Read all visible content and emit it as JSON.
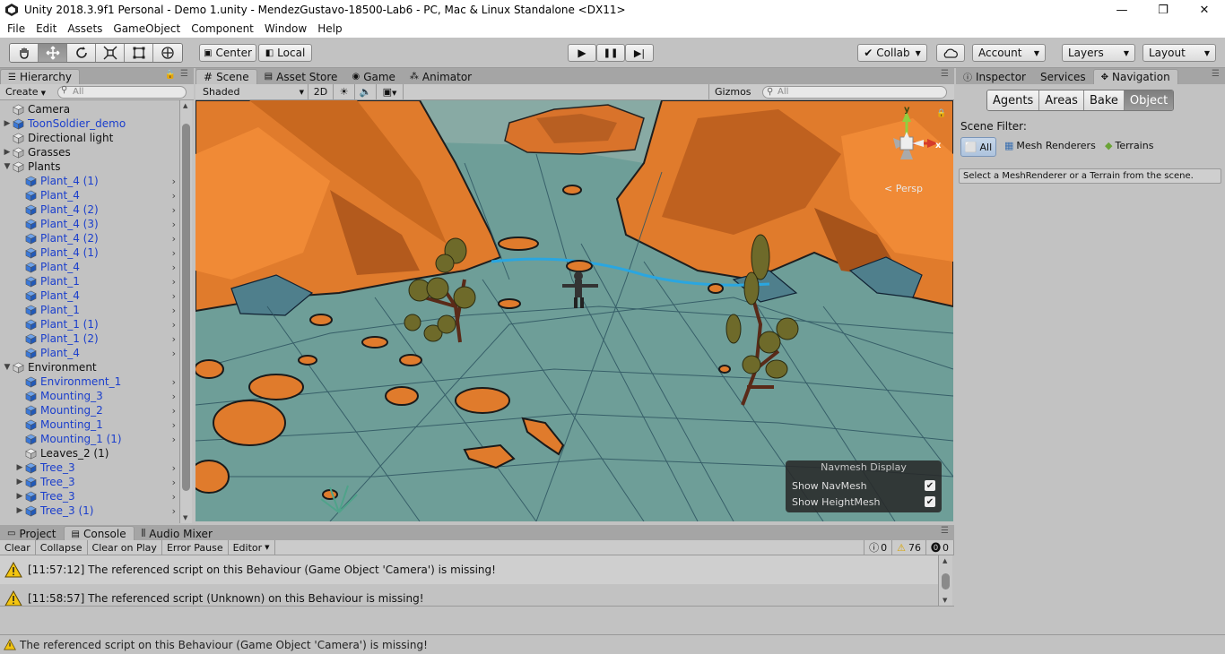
{
  "window": {
    "title": "Unity 2018.3.9f1 Personal - Demo 1.unity - MendezGustavo-18500-Lab6 - PC, Mac & Linux Standalone <DX11>",
    "controls": [
      "—",
      "❐",
      "✕"
    ]
  },
  "menu": [
    "File",
    "Edit",
    "Assets",
    "GameObject",
    "Component",
    "Window",
    "Help"
  ],
  "toolbar": {
    "tools": [
      "hand-tool-icon",
      "move-tool-icon",
      "rotate-tool-icon",
      "scale-tool-icon",
      "rect-tool-icon",
      "transform-tool-icon"
    ],
    "pivot_mode": "Center",
    "pivot_rotation": "Local",
    "play": "▶",
    "pause": "❚❚",
    "step": "▶|",
    "collab": "Collab",
    "account": "Account",
    "layers": "Layers",
    "layout": "Layout"
  },
  "hierarchy": {
    "tab": "Hierarchy",
    "create": "Create",
    "search_placeholder": "All",
    "items": [
      {
        "label": "Camera",
        "indent": 0,
        "arrow": "",
        "prefab": false,
        "chevron": false
      },
      {
        "label": "ToonSoldier_demo",
        "indent": 0,
        "arrow": "▶",
        "prefab": true,
        "chevron": false
      },
      {
        "label": "Directional light",
        "indent": 0,
        "arrow": "",
        "prefab": false,
        "chevron": false
      },
      {
        "label": "Grasses",
        "indent": 0,
        "arrow": "▶",
        "prefab": false,
        "chevron": false
      },
      {
        "label": "Plants",
        "indent": 0,
        "arrow": "▼",
        "prefab": false,
        "chevron": false
      },
      {
        "label": "Plant_4 (1)",
        "indent": 1,
        "arrow": "",
        "prefab": true,
        "chevron": true
      },
      {
        "label": "Plant_4",
        "indent": 1,
        "arrow": "",
        "prefab": true,
        "chevron": true
      },
      {
        "label": "Plant_4 (2)",
        "indent": 1,
        "arrow": "",
        "prefab": true,
        "chevron": true
      },
      {
        "label": "Plant_4 (3)",
        "indent": 1,
        "arrow": "",
        "prefab": true,
        "chevron": true
      },
      {
        "label": "Plant_4 (2)",
        "indent": 1,
        "arrow": "",
        "prefab": true,
        "chevron": true
      },
      {
        "label": "Plant_4 (1)",
        "indent": 1,
        "arrow": "",
        "prefab": true,
        "chevron": true
      },
      {
        "label": "Plant_4",
        "indent": 1,
        "arrow": "",
        "prefab": true,
        "chevron": true
      },
      {
        "label": "Plant_1",
        "indent": 1,
        "arrow": "",
        "prefab": true,
        "chevron": true
      },
      {
        "label": "Plant_4",
        "indent": 1,
        "arrow": "",
        "prefab": true,
        "chevron": true
      },
      {
        "label": "Plant_1",
        "indent": 1,
        "arrow": "",
        "prefab": true,
        "chevron": true
      },
      {
        "label": "Plant_1 (1)",
        "indent": 1,
        "arrow": "",
        "prefab": true,
        "chevron": true
      },
      {
        "label": "Plant_1 (2)",
        "indent": 1,
        "arrow": "",
        "prefab": true,
        "chevron": true
      },
      {
        "label": "Plant_4",
        "indent": 1,
        "arrow": "",
        "prefab": true,
        "chevron": true
      },
      {
        "label": "Environment",
        "indent": 0,
        "arrow": "▼",
        "prefab": false,
        "chevron": false
      },
      {
        "label": "Environment_1",
        "indent": 1,
        "arrow": "",
        "prefab": true,
        "chevron": true
      },
      {
        "label": "Mounting_3",
        "indent": 1,
        "arrow": "",
        "prefab": true,
        "chevron": true
      },
      {
        "label": "Mounting_2",
        "indent": 1,
        "arrow": "",
        "prefab": true,
        "chevron": true
      },
      {
        "label": "Mounting_1",
        "indent": 1,
        "arrow": "",
        "prefab": true,
        "chevron": true
      },
      {
        "label": "Mounting_1 (1)",
        "indent": 1,
        "arrow": "",
        "prefab": true,
        "chevron": true
      },
      {
        "label": "Leaves_2 (1)",
        "indent": 1,
        "arrow": "",
        "prefab": false,
        "chevron": false
      },
      {
        "label": "Tree_3",
        "indent": 1,
        "arrow": "▶",
        "prefab": true,
        "chevron": true
      },
      {
        "label": "Tree_3",
        "indent": 1,
        "arrow": "▶",
        "prefab": true,
        "chevron": true
      },
      {
        "label": "Tree_3",
        "indent": 1,
        "arrow": "▶",
        "prefab": true,
        "chevron": true
      },
      {
        "label": "Tree_3 (1)",
        "indent": 1,
        "arrow": "▶",
        "prefab": true,
        "chevron": true
      }
    ]
  },
  "scene_tabs": [
    "Scene",
    "Asset Store",
    "Game",
    "Animator"
  ],
  "scene_toolbar": {
    "draw_mode": "Shaded",
    "mode_2d": "2D",
    "gizmos": "Gizmos",
    "search_placeholder": "All",
    "persp_label": "Persp",
    "axis_x": "x",
    "axis_y": "y"
  },
  "navmesh_display": {
    "title": "Navmesh Display",
    "rows": [
      {
        "label": "Show NavMesh",
        "checked": true
      },
      {
        "label": "Show HeightMesh",
        "checked": true
      }
    ]
  },
  "inspector": {
    "tabs": [
      "Inspector",
      "Services",
      "Navigation"
    ],
    "nav_tabs": [
      "Agents",
      "Areas",
      "Bake",
      "Object"
    ],
    "scene_filter_label": "Scene Filter:",
    "filters": [
      "All",
      "Mesh Renderers",
      "Terrains"
    ],
    "hint": "Select a MeshRenderer or a Terrain from the scene."
  },
  "console": {
    "tabs": [
      "Project",
      "Console",
      "Audio Mixer"
    ],
    "buttons": [
      "Clear",
      "Collapse",
      "Clear on Play",
      "Error Pause",
      "Editor"
    ],
    "counts": {
      "info": "0",
      "warn": "76",
      "error": "0"
    },
    "lines": [
      "[11:57:12] The referenced script on this Behaviour (Game Object 'Camera') is missing!",
      "[11:58:57] The referenced script (Unknown) on this Behaviour is missing!"
    ]
  },
  "status": "The referenced script on this Behaviour (Game Object 'Camera') is missing!",
  "colors": {
    "terrain_orange": "#e07b2c",
    "ground_teal": "#6e9e98",
    "prefab_blue": "#1a3ecc",
    "panel_bg": "#c2c2c2"
  }
}
